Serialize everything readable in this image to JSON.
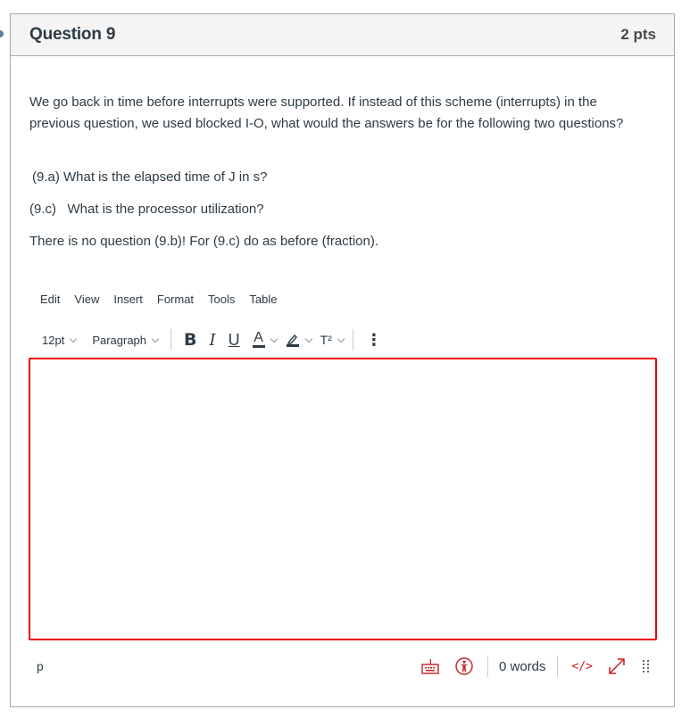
{
  "question": {
    "title": "Question 9",
    "points": "2 pts",
    "paragraphs": [
      "We go back in time before interrupts were supported. If instead of this scheme (interrupts) in the previous question,  we used blocked I-O, what would the answers be for the following two questions?",
      "(9.a) What is the elapsed time of J in s?",
      "(9.c)   What is the processor utilization?",
      "There is no question (9.b)! For (9.c) do as before (fraction)."
    ]
  },
  "editor": {
    "menu": [
      "Edit",
      "View",
      "Insert",
      "Format",
      "Tools",
      "Table"
    ],
    "toolbar": {
      "font_size": "12pt",
      "block_format": "Paragraph",
      "bold": "B",
      "italic": "I",
      "underline": "U",
      "text_color": "A",
      "superscript": "T²",
      "more": "⋮"
    },
    "content": "",
    "statusbar": {
      "path": "p",
      "word_count": "0 words",
      "html_toggle": "</>"
    },
    "colors": {
      "focus_border": "#ee0000",
      "icon_accent": "#c71f23",
      "text": "#2d3b45"
    }
  }
}
